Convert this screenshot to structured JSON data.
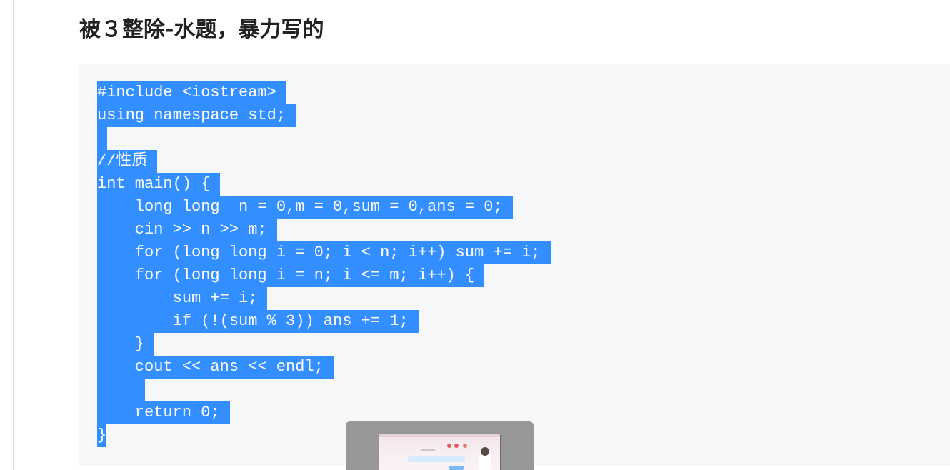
{
  "article": {
    "heading": "被３整除-水题，暴力写的"
  },
  "code": {
    "lines": [
      "#include <iostream>",
      "using namespace std;",
      "",
      "//性质",
      "int main() {",
      "    long long  n = 0,m = 0,sum = 0,ans = 0;",
      "    cin >> n >> m;",
      "    for (long long i = 0; i < n; i++) sum += i;",
      "    for (long long i = n; i <= m; i++) {",
      "        sum += i;",
      "        if (!(sum % 3)) ans += 1;",
      "    }",
      "    cout << ans << endl;",
      "    ",
      "    return 0;",
      "}"
    ],
    "selection_color": "#338fff",
    "background_color": "#f6f7f9"
  },
  "overlay": {
    "type": "window-thumbnail"
  }
}
